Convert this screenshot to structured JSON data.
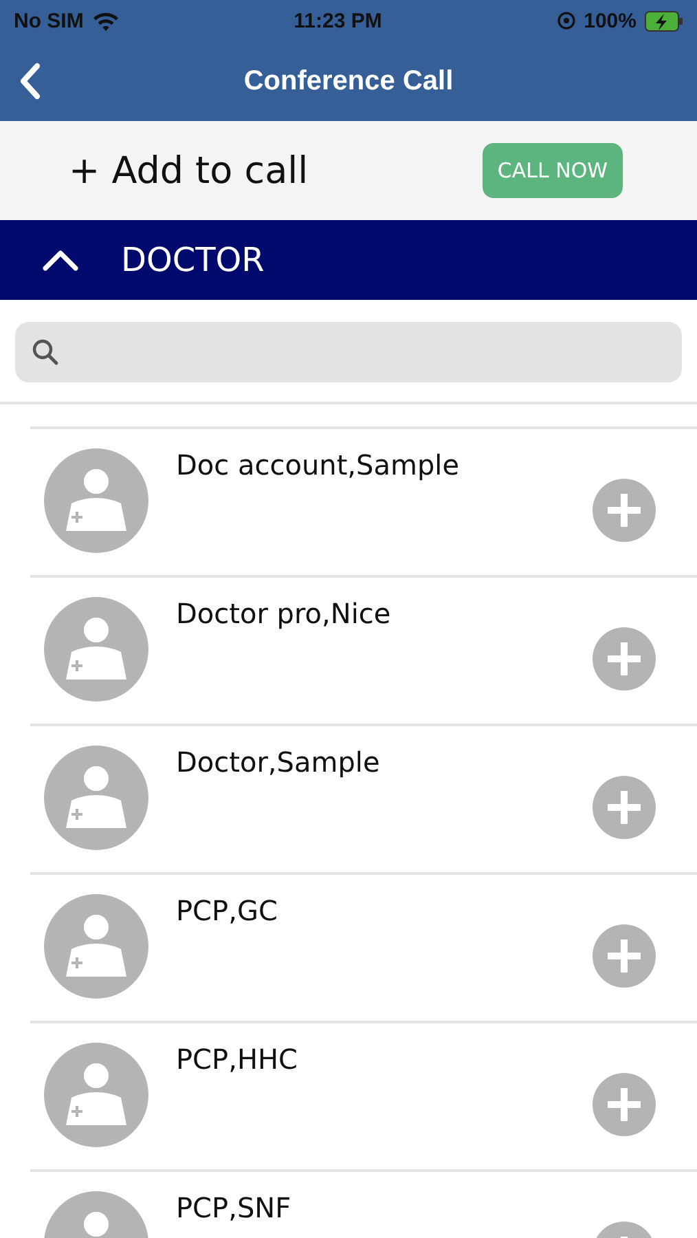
{
  "status_bar": {
    "carrier": "No SIM",
    "time": "11:23 PM",
    "battery": "100%"
  },
  "nav_bar": {
    "title": "Conference Call"
  },
  "add_bar": {
    "label": "+ Add to call",
    "button": "CALL NOW"
  },
  "section": {
    "title": "DOCTOR",
    "expanded": true
  },
  "contacts": [
    {
      "name": "Doc account,Sample"
    },
    {
      "name": "Doctor pro,Nice"
    },
    {
      "name": "Doctor,Sample"
    },
    {
      "name": "PCP,GC"
    },
    {
      "name": "PCP,HHC"
    },
    {
      "name": "PCP,SNF"
    }
  ]
}
